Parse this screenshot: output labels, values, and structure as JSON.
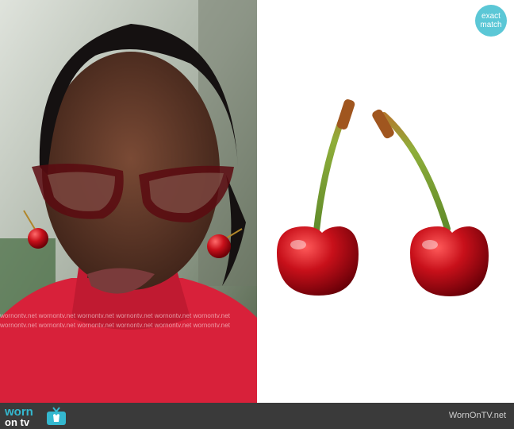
{
  "badge": {
    "line1": "exact",
    "line2": "match"
  },
  "watermark": {
    "row_text": "wornontv.net wornontv.net wornontv.net wornontv.net wornontv.net wornontv.net"
  },
  "footer": {
    "logo_top": "worn",
    "logo_bottom": "on tv",
    "site_url": "WornOnTV.net"
  },
  "colors": {
    "badge": "#5bc7d6",
    "footer_bg": "#3a3a3a",
    "logo_accent": "#34b8cf",
    "cherry_red": "#c8101a",
    "stem_green": "#8fae3a"
  }
}
